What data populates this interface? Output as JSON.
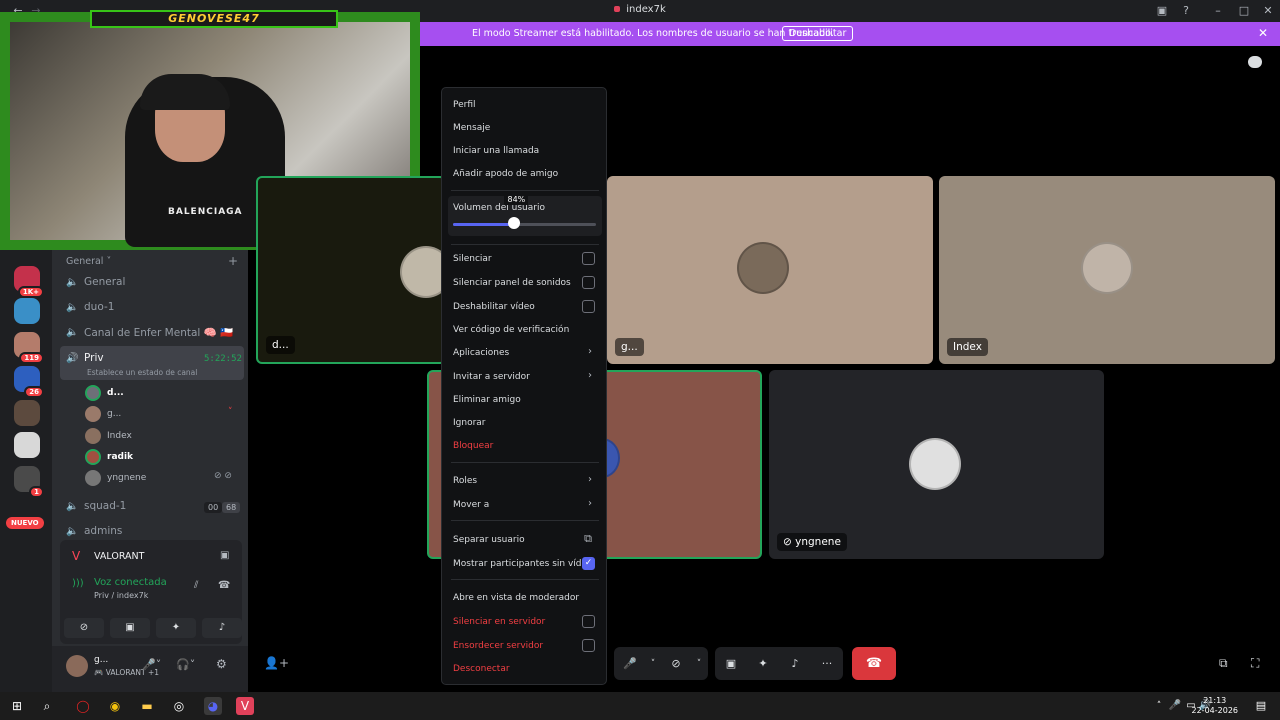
{
  "window": {
    "title": "index7k"
  },
  "banner": {
    "message": "El modo Streamer está habilitado. Los nombres de usuario se han truncado.",
    "action": "Deshabilitar"
  },
  "overlay": {
    "cam_title": "GENOVESE47",
    "shirt_text": "BALENCIAGA"
  },
  "rail": {
    "badges": [
      "1K+",
      "119",
      "26",
      "1"
    ],
    "nuevo": "NUEVO"
  },
  "sidebar": {
    "category": "General",
    "channels": [
      {
        "name": "General"
      },
      {
        "name": "duo-1"
      },
      {
        "name": "Canal de Enfer Mental 🧠 🇨🇱"
      },
      {
        "name": "Priv",
        "timer": "5:22:52",
        "status": "Establece un estado de canal"
      },
      {
        "name": "squad-1",
        "count_a": "00",
        "count_b": "68"
      },
      {
        "name": "admins"
      }
    ],
    "voice_users": [
      "d...",
      "g...",
      "Index",
      "radik",
      "yngnene"
    ],
    "activity": "VALORANT",
    "voice_status": "Voz conectada",
    "voice_location": "Priv / index7k",
    "user": {
      "name": "g...",
      "sub": "VALORANT +1"
    }
  },
  "tiles": [
    {
      "label": "d..."
    },
    {
      "label": "g..."
    },
    {
      "label": "Index"
    },
    {
      "label": ""
    },
    {
      "label": "yngnene"
    }
  ],
  "menu": {
    "items": [
      "Perfil",
      "Mensaje",
      "Iniciar una llamada",
      "Añadir apodo de amigo",
      "Volumen del usuario",
      "Silenciar",
      "Silenciar panel de sonidos",
      "Deshabilitar vídeo",
      "Ver código de verificación",
      "Aplicaciones",
      "Invitar a servidor",
      "Eliminar amigo",
      "Ignorar",
      "Bloquear",
      "Roles",
      "Mover a",
      "Separar usuario",
      "Mostrar participantes sin vídeo",
      "Abre en vista de moderador",
      "Silenciar en servidor",
      "Ensordecer servidor",
      "Desconectar"
    ],
    "volume_percent": 84,
    "volume_label": "84%"
  },
  "taskbar": {
    "time": "21:13",
    "date": "22-04-2026"
  },
  "colors": {
    "accent": "#5865f2",
    "danger": "#f23f43",
    "banner": "#a64ff0",
    "speaking": "#23a55a"
  }
}
